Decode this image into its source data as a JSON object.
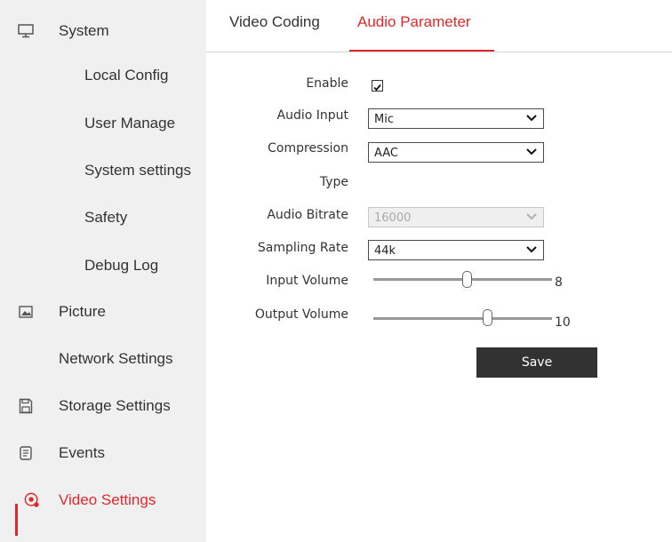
{
  "sidebar": {
    "items": [
      {
        "label": "System",
        "icon": "monitor-icon"
      },
      {
        "label": "Local Config"
      },
      {
        "label": "User Manage"
      },
      {
        "label": "System settings"
      },
      {
        "label": "Safety"
      },
      {
        "label": "Debug Log"
      },
      {
        "label": "Picture",
        "icon": "picture-icon"
      },
      {
        "label": "Network Settings"
      },
      {
        "label": "Storage Settings",
        "icon": "save-disk-icon"
      },
      {
        "label": "Events",
        "icon": "events-icon"
      },
      {
        "label": "Video Settings",
        "icon": "video-settings-icon",
        "active": true
      }
    ],
    "active_color": "#e0282c"
  },
  "tabs": [
    {
      "label": "Video Coding",
      "active": false
    },
    {
      "label": "Audio Parameter",
      "active": true
    }
  ],
  "form": {
    "enable": {
      "label": "Enable",
      "checked": true
    },
    "audio_input": {
      "label": "Audio Input",
      "value": "Mic"
    },
    "compression_type": {
      "label_line1": "Compression",
      "label_line2": "Type",
      "value": "AAC"
    },
    "audio_bitrate": {
      "label": "Audio Bitrate",
      "value": "16000",
      "disabled": true
    },
    "sampling_rate": {
      "label": "Sampling Rate",
      "value": "44k"
    },
    "input_volume": {
      "label": "Input Volume",
      "value": "8"
    },
    "output_volume": {
      "label": "Output Volume",
      "value": "10"
    },
    "save_label": "Save"
  }
}
